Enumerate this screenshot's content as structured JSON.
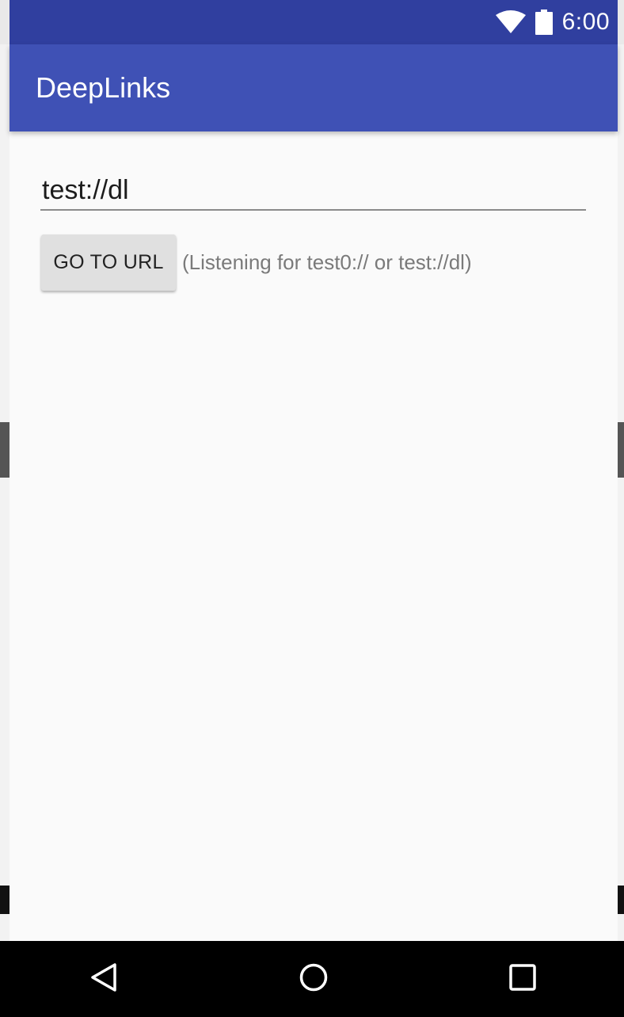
{
  "status_bar": {
    "time": "6:00",
    "icons": [
      "wifi-icon",
      "battery-icon"
    ],
    "color": "#303f9f"
  },
  "app_bar": {
    "title": "DeepLinks",
    "color": "#3f51b5"
  },
  "main": {
    "url_input": {
      "value": "test://dl"
    },
    "go_button": {
      "label": "GO TO URL"
    },
    "hint": "(Listening for test0:// or test://dl)"
  },
  "nav_bar": {
    "icons": [
      "back-icon",
      "home-icon",
      "recents-icon"
    ]
  }
}
